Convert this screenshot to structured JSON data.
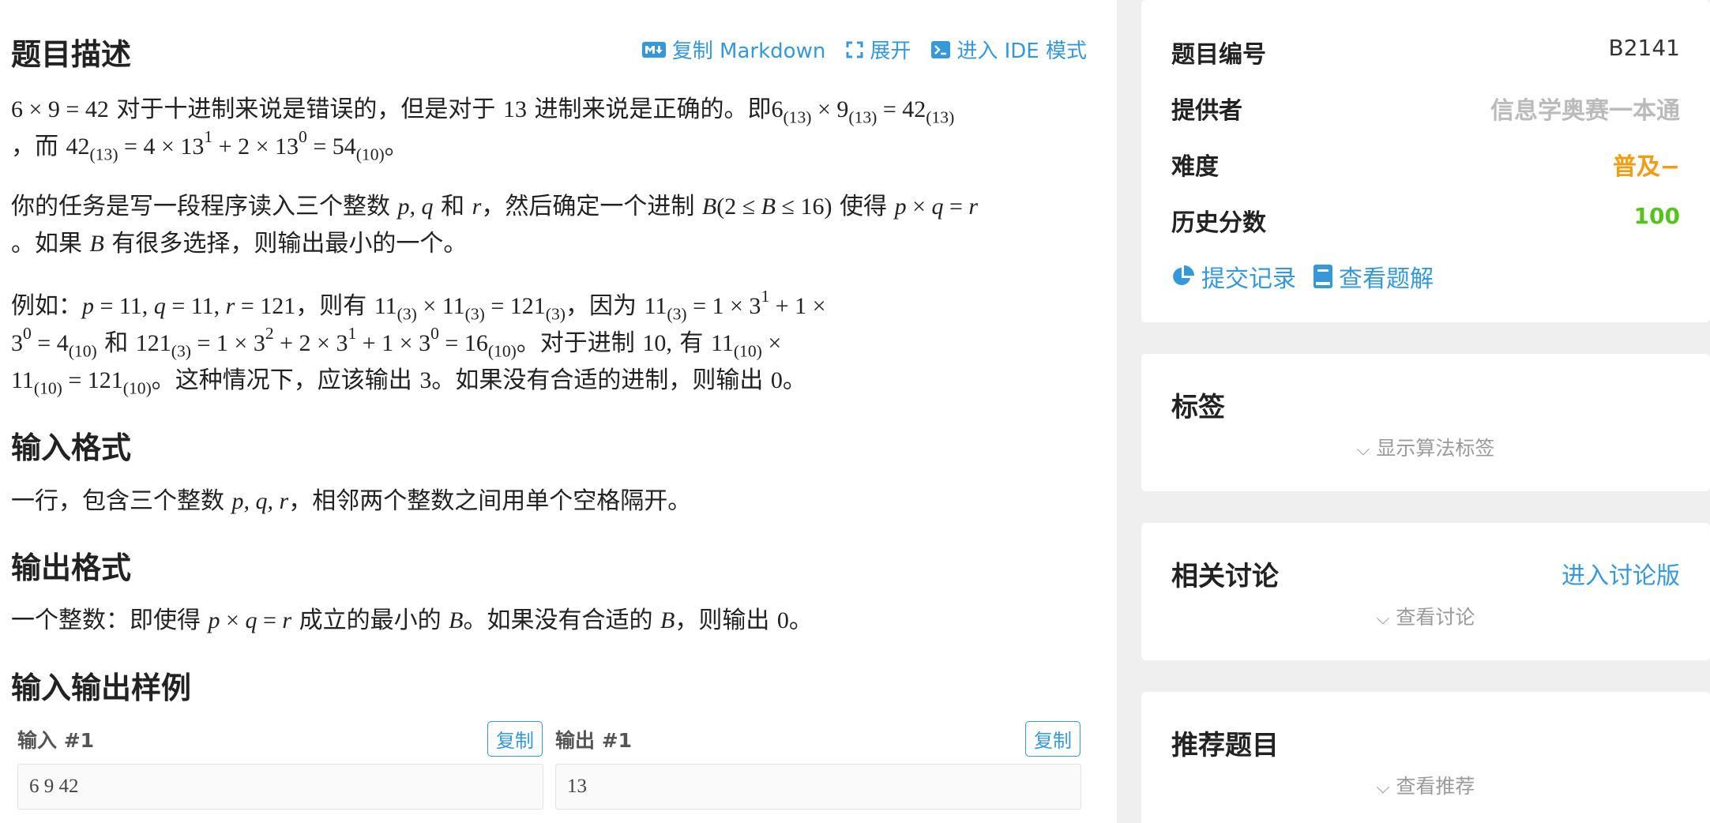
{
  "problem": {
    "heading": "题目描述",
    "actions": {
      "copy_markdown": "复制 Markdown",
      "expand": "展开",
      "ide_mode": "进入 IDE 模式"
    },
    "desc1": {
      "a": "对于十进制来说是错误的，但是对于",
      "b": "进制来说是正确的。即",
      "c": "，而",
      "d": "。"
    },
    "desc2": {
      "a": "你的任务是写一段程序读入三个整数",
      "b": "和",
      "c": "，然后确定一个进制",
      "d": "使得",
      "e": "。如果",
      "f": "有很多选择，则输出最小的一个。"
    },
    "desc3": {
      "a": "例如：",
      "b": "，则有",
      "c": "，因为",
      "d": "和",
      "e": "。对于进制",
      "f": "有",
      "g": "。这种情况下，应该输出",
      "h": "。如果没有合适的进制，则输出",
      "i": "。"
    },
    "input_heading": "输入格式",
    "input_text": {
      "a": "一行，包含三个整数",
      "b": "，相邻两个整数之间用单个空格隔开。"
    },
    "output_heading": "输出格式",
    "output_text": {
      "a": "一个整数：即使得",
      "b": "成立的最小的",
      "c": "。如果没有合适的",
      "d": "，则输出",
      "e": "。"
    },
    "samples_heading": "输入输出样例",
    "samples": {
      "input_label": "输入 #1",
      "output_label": "输出 #1",
      "copy_label": "复制",
      "input_value": "6 9 42",
      "output_value": "13"
    }
  },
  "sidebar": {
    "info": {
      "id_label": "题目编号",
      "id_value": "B2141",
      "provider_label": "提供者",
      "provider_value": "信息学奥赛一本通",
      "difficulty_label": "难度",
      "difficulty_value": "普及−",
      "score_label": "历史分数",
      "score_value": "100",
      "submissions_link": "提交记录",
      "solutions_link": "查看题解"
    },
    "tags": {
      "title": "标签",
      "toggle": "显示算法标签"
    },
    "discussion": {
      "title": "相关讨论",
      "enter": "进入讨论版",
      "toggle": "查看讨论"
    },
    "recommend": {
      "title": "推荐题目",
      "toggle": "查看推荐"
    },
    "colors": {
      "accent": "#3498db",
      "difficulty": "#f39c11",
      "score": "#52c41a",
      "muted": "#bbbbbb"
    }
  }
}
